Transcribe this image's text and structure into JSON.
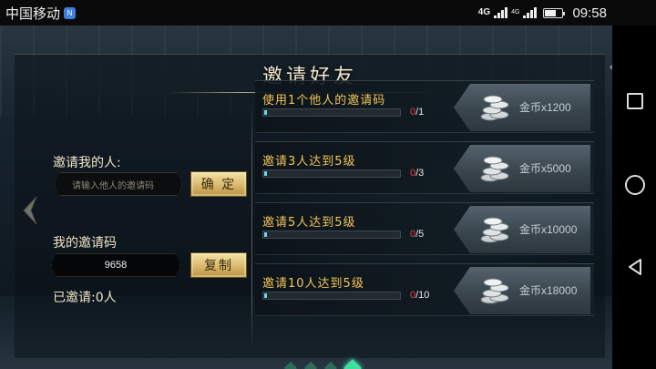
{
  "status_bar": {
    "carrier": "中国移动",
    "carrier_badge": "N",
    "network": "4G",
    "network_small": "4G",
    "time": "09:58"
  },
  "panel": {
    "title": "邀请好友"
  },
  "invite": {
    "inviter_label": "邀请我的人:",
    "code_placeholder": "请输入他人的邀请码",
    "confirm_label": "确 定",
    "my_code_label": "我的邀请码",
    "my_code": "9658",
    "copy_label": "复制",
    "invited_count": "已邀请:0人"
  },
  "tasks": [
    {
      "title": "使用1个他人的邀请码",
      "current": "0",
      "target": "/1",
      "progress": 0,
      "reward": "金币x1200"
    },
    {
      "title": "邀请3人达到5级",
      "current": "0",
      "target": "/3",
      "progress": 0,
      "reward": "金币x5000"
    },
    {
      "title": "邀请5人达到5级",
      "current": "0",
      "target": "/5",
      "progress": 0,
      "reward": "金币x10000"
    },
    {
      "title": "邀请10人达到5级",
      "current": "0",
      "target": "/10",
      "progress": 0,
      "reward": "金币x18000"
    }
  ],
  "pagination": {
    "total": 4,
    "active": 4
  },
  "colors": {
    "task_title": "#f1c456",
    "progress_current": "#e8433a",
    "progress_fill": "#56c8e6",
    "active_dot": "#3de0a1"
  },
  "icons": {
    "back": "chevron-left-icon",
    "coins": "coin-stack-icon"
  }
}
